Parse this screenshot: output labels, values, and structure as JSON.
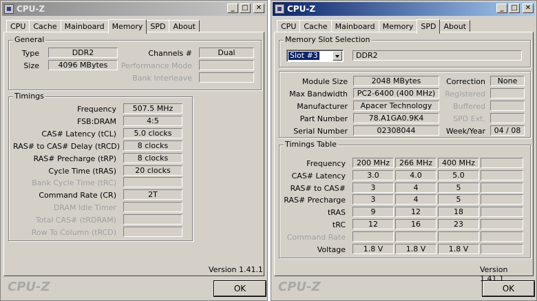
{
  "win1": {
    "title": "CPU-Z",
    "tabs": [
      "CPU",
      "Cache",
      "Mainboard",
      "Memory",
      "SPD",
      "About"
    ],
    "active_tab": "Memory",
    "general": {
      "title": "General",
      "type_label": "Type",
      "type_value": "DDR2",
      "size_label": "Size",
      "size_value": "4096 MBytes",
      "channels_label": "Channels #",
      "channels_value": "Dual",
      "perf_mode_label": "Performance Mode",
      "perf_mode_value": "",
      "bank_interleave_label": "Bank Interleave",
      "bank_interleave_value": ""
    },
    "timings": {
      "title": "Timings",
      "rows": [
        {
          "label": "Frequency",
          "value": "507.5 MHz",
          "enabled": true
        },
        {
          "label": "FSB:DRAM",
          "value": "4:5",
          "enabled": true
        },
        {
          "label": "CAS# Latency (tCL)",
          "value": "5.0 clocks",
          "enabled": true
        },
        {
          "label": "RAS# to CAS# Delay (tRCD)",
          "value": "8 clocks",
          "enabled": true
        },
        {
          "label": "RAS# Precharge (tRP)",
          "value": "8 clocks",
          "enabled": true
        },
        {
          "label": "Cycle Time (tRAS)",
          "value": "20 clocks",
          "enabled": true
        },
        {
          "label": "Bank Cycle Time (tRC)",
          "value": "",
          "enabled": false
        },
        {
          "label": "Command Rate (CR)",
          "value": "2T",
          "enabled": true
        },
        {
          "label": "DRAM Idle Timer",
          "value": "",
          "enabled": false
        },
        {
          "label": "Total CAS# (tRDRAM)",
          "value": "",
          "enabled": false
        },
        {
          "label": "Row To Column (tRCD)",
          "value": "",
          "enabled": false
        }
      ]
    },
    "version": "Version 1.41.1",
    "logo": "CPU-Z",
    "ok_label": "OK"
  },
  "win2": {
    "title": "CPU-Z",
    "tabs": [
      "CPU",
      "Cache",
      "Mainboard",
      "Memory",
      "SPD",
      "About"
    ],
    "active_tab": "SPD",
    "slot": {
      "title": "Memory Slot Selection",
      "selected": "Slot #3",
      "type": "DDR2"
    },
    "module": {
      "module_size_label": "Module Size",
      "module_size": "2048 MBytes",
      "max_bw_label": "Max Bandwidth",
      "max_bw": "PC2-6400 (400 MHz)",
      "manufacturer_label": "Manufacturer",
      "manufacturer": "Apacer Technology",
      "part_label": "Part Number",
      "part": "78.A1GA0.9K4",
      "serial_label": "Serial Number",
      "serial": "02308044",
      "correction_label": "Correction",
      "correction": "None",
      "registered_label": "Registered",
      "registered": "",
      "buffered_label": "Buffered",
      "buffered": "",
      "spd_ext_label": "SPD Ext.",
      "spd_ext": "",
      "week_year_label": "Week/Year",
      "week_year": "04 / 08"
    },
    "timings_table": {
      "title": "Timings Table",
      "rows": [
        {
          "label": "Frequency",
          "values": [
            "200 MHz",
            "266 MHz",
            "400 MHz",
            ""
          ],
          "enabled": true
        },
        {
          "label": "CAS# Latency",
          "values": [
            "3.0",
            "4.0",
            "5.0",
            ""
          ],
          "enabled": true
        },
        {
          "label": "RAS# to CAS#",
          "values": [
            "3",
            "4",
            "5",
            ""
          ],
          "enabled": true
        },
        {
          "label": "RAS# Precharge",
          "values": [
            "3",
            "4",
            "5",
            ""
          ],
          "enabled": true
        },
        {
          "label": "tRAS",
          "values": [
            "9",
            "12",
            "18",
            ""
          ],
          "enabled": true
        },
        {
          "label": "tRC",
          "values": [
            "12",
            "16",
            "23",
            ""
          ],
          "enabled": true
        },
        {
          "label": "Command Rate",
          "values": [
            "",
            "",
            "",
            ""
          ],
          "enabled": false
        },
        {
          "label": "Voltage",
          "values": [
            "1.8 V",
            "1.8 V",
            "1.8 V",
            ""
          ],
          "enabled": true
        }
      ]
    },
    "version": "Version 1.41.1",
    "logo": "CPU-Z",
    "ok_label": "OK"
  }
}
